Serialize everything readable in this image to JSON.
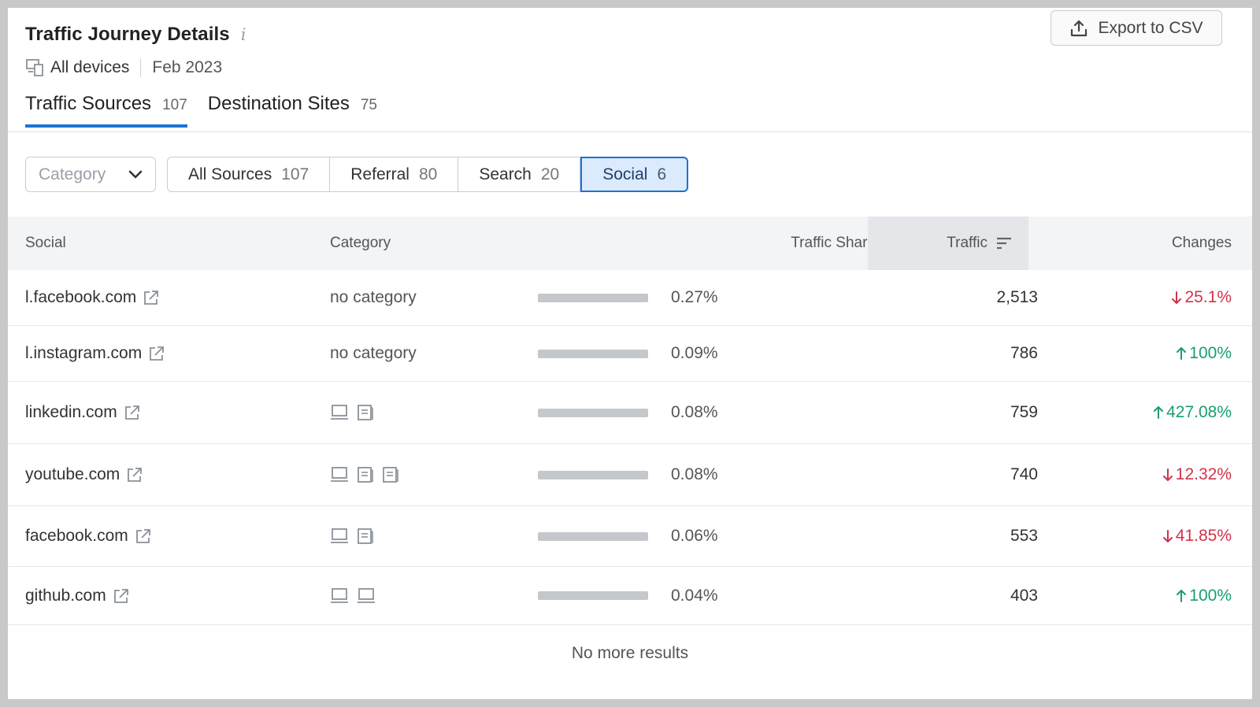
{
  "header": {
    "title": "Traffic Journey Details",
    "info_glyph": "i",
    "devices": "All devices",
    "date": "Feb 2023",
    "export_label": "Export to CSV"
  },
  "tabs": [
    {
      "label": "Traffic Sources",
      "count": "107",
      "active": true
    },
    {
      "label": "Destination Sites",
      "count": "75",
      "active": false
    }
  ],
  "filters": {
    "category_placeholder": "Category",
    "segments": [
      {
        "label": "All Sources",
        "count": "107",
        "active": false
      },
      {
        "label": "Referral",
        "count": "80",
        "active": false
      },
      {
        "label": "Search",
        "count": "20",
        "active": false
      },
      {
        "label": "Social",
        "count": "6",
        "active": true
      }
    ]
  },
  "table": {
    "columns": {
      "source": "Social",
      "category": "Category",
      "share": "Traffic Share",
      "traffic": "Traffic",
      "changes": "Changes"
    },
    "rows": [
      {
        "domain": "l.facebook.com",
        "category": "no category",
        "device_icons": [],
        "share": "0.27%",
        "share_fraction": 0.0027,
        "traffic": "2,513",
        "change": "25.1%",
        "direction": "down"
      },
      {
        "domain": "l.instagram.com",
        "category": "no category",
        "device_icons": [],
        "share": "0.09%",
        "share_fraction": 0.0009,
        "traffic": "786",
        "change": "100%",
        "direction": "up"
      },
      {
        "domain": "linkedin.com",
        "category": "",
        "device_icons": [
          "laptop-icon",
          "document-icon"
        ],
        "share": "0.08%",
        "share_fraction": 0.0008,
        "traffic": "759",
        "change": "427.08%",
        "direction": "up"
      },
      {
        "domain": "youtube.com",
        "category": "",
        "device_icons": [
          "laptop-icon",
          "document-icon",
          "document-icon"
        ],
        "share": "0.08%",
        "share_fraction": 0.0008,
        "traffic": "740",
        "change": "12.32%",
        "direction": "down"
      },
      {
        "domain": "facebook.com",
        "category": "",
        "device_icons": [
          "laptop-icon",
          "document-icon"
        ],
        "share": "0.06%",
        "share_fraction": 0.0006,
        "traffic": "553",
        "change": "41.85%",
        "direction": "down"
      },
      {
        "domain": "github.com",
        "category": "",
        "device_icons": [
          "laptop-icon",
          "laptop-icon"
        ],
        "share": "0.04%",
        "share_fraction": 0.0004,
        "traffic": "403",
        "change": "100%",
        "direction": "up"
      }
    ],
    "footer": "No more results"
  },
  "colors": {
    "accent": "#1a73d2",
    "down": "#d1334a",
    "up": "#199e6c"
  }
}
